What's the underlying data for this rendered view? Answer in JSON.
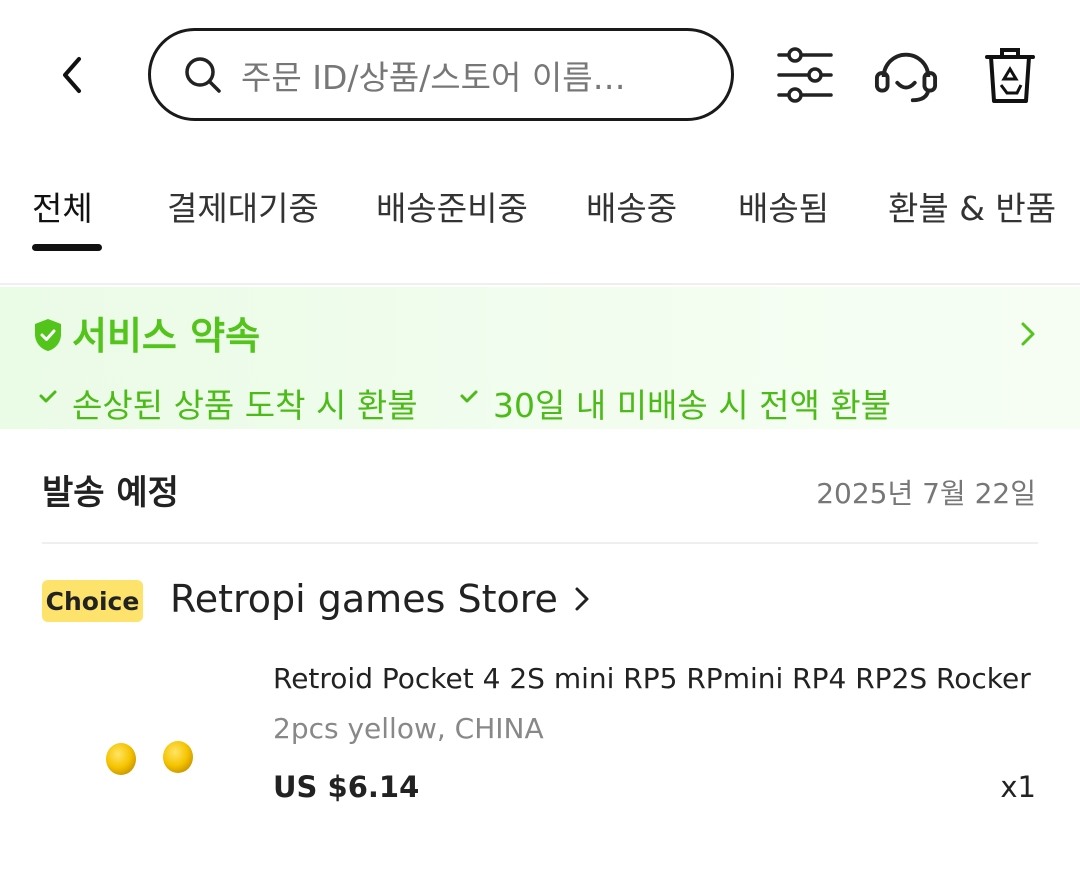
{
  "header": {
    "search_placeholder": "주문 ID/상품/스토어 이름…"
  },
  "tabs": [
    {
      "label": "전체",
      "active": true
    },
    {
      "label": "결제대기중"
    },
    {
      "label": "배송준비중"
    },
    {
      "label": "배송중"
    },
    {
      "label": "배송됨"
    },
    {
      "label": "환불 & 반품"
    }
  ],
  "promise": {
    "title": "서비스 약속",
    "items": [
      "손상된 상품 도착 시 환불",
      "30일 내 미배송 시 전액 환불"
    ],
    "accent_color": "#52c41a"
  },
  "shipment": {
    "title": "발송 예정",
    "date": "2025년 7월 22일"
  },
  "order": {
    "badge": "Choice",
    "badge_color": "#fde36b",
    "store_name": "Retropi games Store",
    "product_name": "Retroid Pocket 4 2S mini RP5 RPmini RP4 RP2S Rocker Thu…",
    "variant": "2pcs yellow, CHINA",
    "price": "US $6.14",
    "quantity": "x1"
  }
}
